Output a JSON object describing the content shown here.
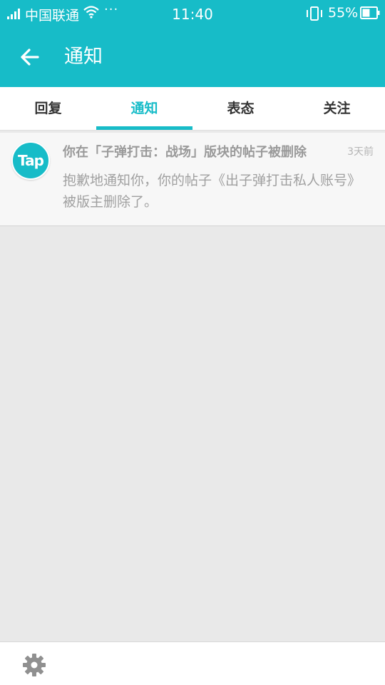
{
  "status_bar": {
    "carrier": "中国联通",
    "more": "···",
    "time": "11:40",
    "battery": "55%",
    "battery_level": 0.55,
    "icons": [
      "signal-icon",
      "wifi-icon",
      "vibrate-icon",
      "battery-icon"
    ]
  },
  "header": {
    "title": "通知",
    "back_icon": "back-arrow-icon"
  },
  "tabs": [
    {
      "label": "回复",
      "active": false
    },
    {
      "label": "通知",
      "active": true
    },
    {
      "label": "表态",
      "active": false
    },
    {
      "label": "关注",
      "active": false
    }
  ],
  "notifications": [
    {
      "avatar_text": "Tap",
      "title": "你在「子弹打击：战场」版块的帖子被删除",
      "time": "3天前",
      "body": "抱歉地通知你，你的帖子《出子弹打击私人账号》被版主删除了。"
    }
  ],
  "bottom_bar": {
    "settings_icon": "gear-icon"
  },
  "colors": {
    "accent": "#17bcc8",
    "background": "#e9e9e9",
    "item_background": "#f7f7f7"
  }
}
